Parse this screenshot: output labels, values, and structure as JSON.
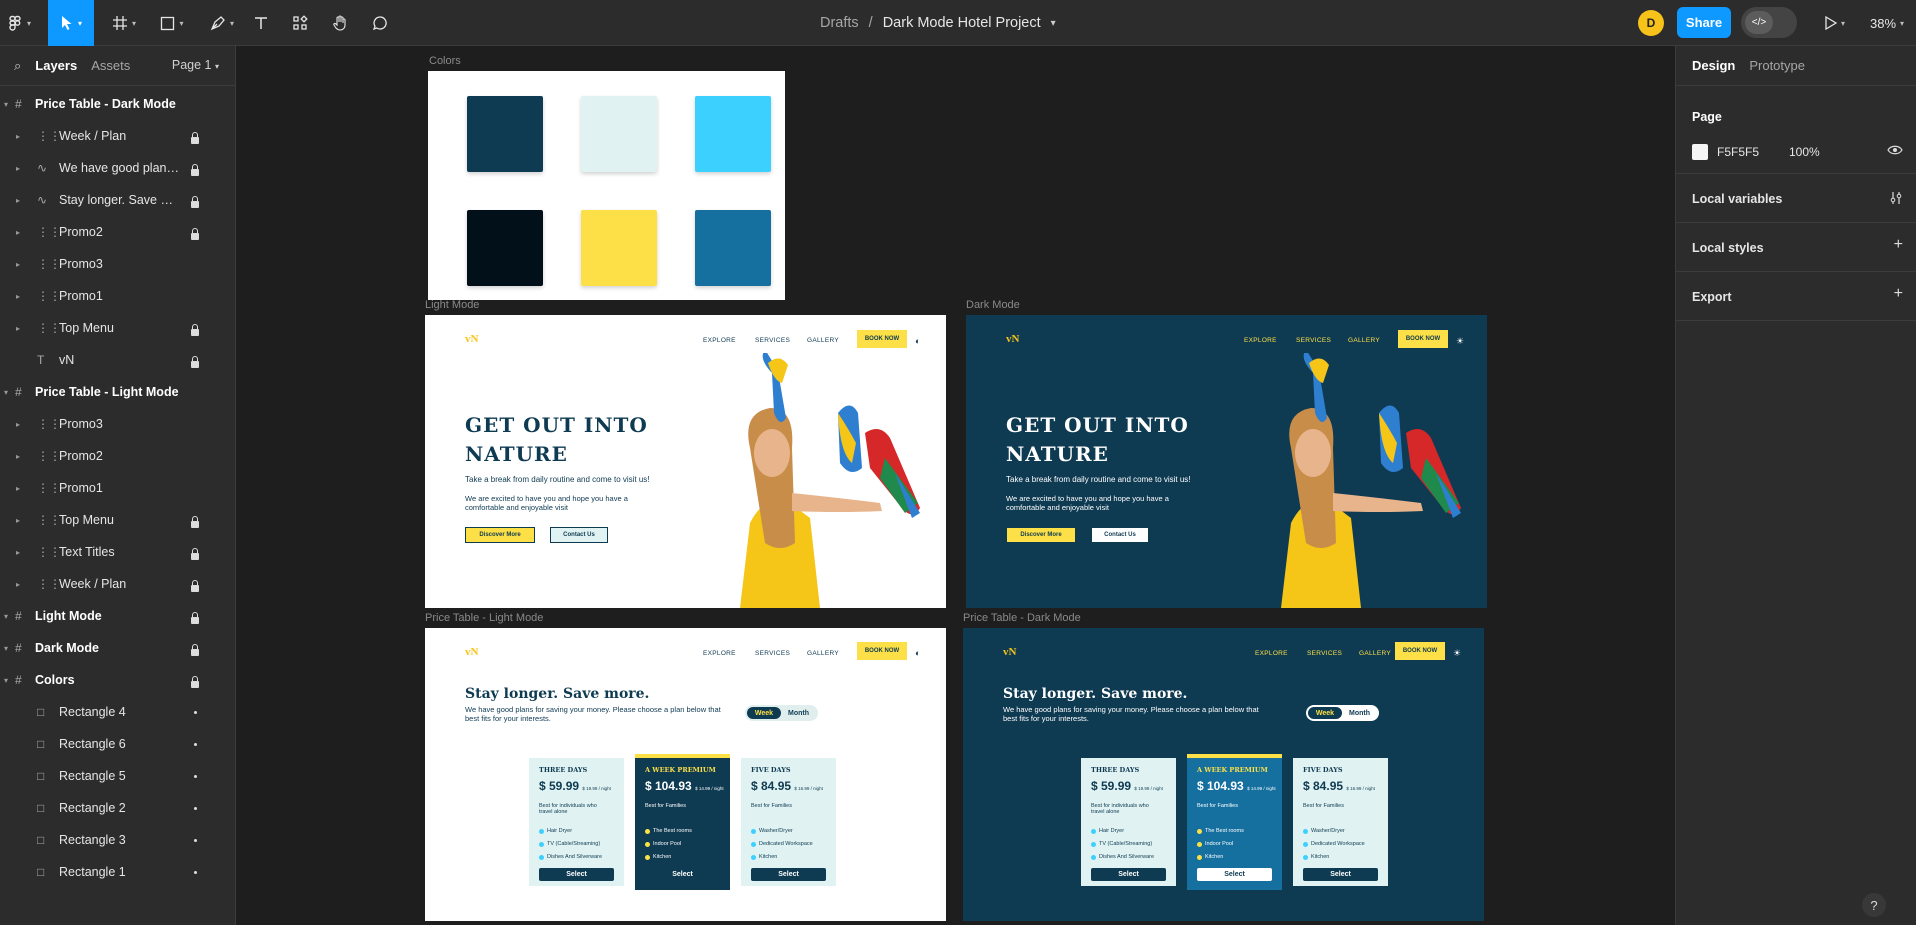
{
  "toolbar": {
    "breadcrumb_root": "Drafts",
    "breadcrumb_sep": "/",
    "file_name": "Dark Mode Hotel Project",
    "avatar_initial": "D",
    "share_label": "Share",
    "zoom_label": "38%",
    "tool_icons": [
      "figma-menu-icon",
      "move-tool-icon",
      "frame-tool-icon",
      "shape-tool-icon",
      "pen-tool-icon",
      "text-tool-icon",
      "resources-icon",
      "hand-tool-icon",
      "comment-icon"
    ]
  },
  "left_panel": {
    "tab_layers": "Layers",
    "tab_assets": "Assets",
    "page_selector": "Page 1",
    "layers": [
      {
        "name": "Price Table - Dark Mode",
        "type": "frame",
        "top": true,
        "locked": false
      },
      {
        "name": "Week / Plan",
        "type": "group",
        "locked": true
      },
      {
        "name": "We have good plans ...",
        "type": "vector",
        "locked": true
      },
      {
        "name": "Stay longer. Save mo...",
        "type": "vector",
        "locked": true
      },
      {
        "name": "Promo2",
        "type": "group",
        "locked": true
      },
      {
        "name": "Promo3",
        "type": "group",
        "locked": false
      },
      {
        "name": "Promo1",
        "type": "group",
        "locked": false
      },
      {
        "name": "Top Menu",
        "type": "group",
        "locked": true
      },
      {
        "name": "vN",
        "type": "text",
        "locked": true
      },
      {
        "name": "Price Table - Light Mode",
        "type": "frame",
        "top": true,
        "locked": false
      },
      {
        "name": "Promo3",
        "type": "group",
        "locked": false
      },
      {
        "name": "Promo2",
        "type": "group",
        "locked": false
      },
      {
        "name": "Promo1",
        "type": "group",
        "locked": false
      },
      {
        "name": "Top Menu",
        "type": "group",
        "locked": true
      },
      {
        "name": "Text Titles",
        "type": "group",
        "locked": true
      },
      {
        "name": "Week / Plan",
        "type": "group",
        "locked": true
      },
      {
        "name": "Light Mode",
        "type": "frame",
        "top": true,
        "locked": true
      },
      {
        "name": "Dark Mode",
        "type": "frame",
        "top": true,
        "locked": true
      },
      {
        "name": "Colors",
        "type": "frame",
        "top": true,
        "locked": true
      },
      {
        "name": "Rectangle 4",
        "type": "rect",
        "dot": true
      },
      {
        "name": "Rectangle 6",
        "type": "rect",
        "dot": true
      },
      {
        "name": "Rectangle 5",
        "type": "rect",
        "dot": true
      },
      {
        "name": "Rectangle 2",
        "type": "rect",
        "dot": true
      },
      {
        "name": "Rectangle 3",
        "type": "rect",
        "dot": true
      },
      {
        "name": "Rectangle 1",
        "type": "rect",
        "dot": true
      }
    ]
  },
  "canvas": {
    "colors_label": "Colors",
    "swatches": [
      "#0e3a52",
      "#e0f2f1",
      "#3cd0ff",
      "#02101a",
      "#fde047",
      "#1570a0"
    ],
    "light_label": "Light Mode",
    "dark_label": "Dark Mode",
    "price_light_label": "Price Table - Light Mode",
    "price_dark_label": "Price Table - Dark Mode",
    "site": {
      "logo": "vN",
      "nav_explore": "EXPLORE",
      "nav_services": "SERVICES",
      "nav_gallery": "GALLERY",
      "book_now": "BOOK NOW",
      "hero_title": "GET OUT INTO NATURE",
      "hero_p1": "Take a break from daily routine and come to visit us!",
      "hero_p2": "We are excited to have you and hope you have a comfortable and enjoyable visit",
      "btn_discover": "Discover More",
      "btn_contact": "Contact Us",
      "price_title": "Stay longer. Save more.",
      "price_sub": "We have good plans for saving your money. Please choose a plan below that best fits for your interests.",
      "toggle_week": "Week",
      "toggle_month": "Month",
      "select": "Select",
      "cards": [
        {
          "title": "THREE DAYS",
          "price": "$ 59.99",
          "small": "$ 19.99 / night",
          "for": "Best for individuals who travel alone",
          "features": [
            "Hair Dryer",
            "TV (Cable/Streaming)",
            "Dishes And Silverware"
          ]
        },
        {
          "title": "A WEEK PREMIUM",
          "price": "$ 104.93",
          "small": "$ 14.99 / night",
          "for": "Best for Families",
          "features": [
            "The Best rooms",
            "Indoor Pool",
            "Kitchen"
          ]
        },
        {
          "title": "FIVE DAYS",
          "price": "$ 84.95",
          "small": "$ 16.99 / night",
          "for": "Best for Families",
          "features": [
            "Washer/Dryer",
            "Dedicated Workspace",
            "Kitchen"
          ]
        }
      ]
    }
  },
  "right_panel": {
    "tab_design": "Design",
    "tab_prototype": "Prototype",
    "page_heading": "Page",
    "page_color": "F5F5F5",
    "page_opacity": "100%",
    "local_variables": "Local variables",
    "local_styles": "Local styles",
    "export": "Export"
  },
  "help": "?"
}
